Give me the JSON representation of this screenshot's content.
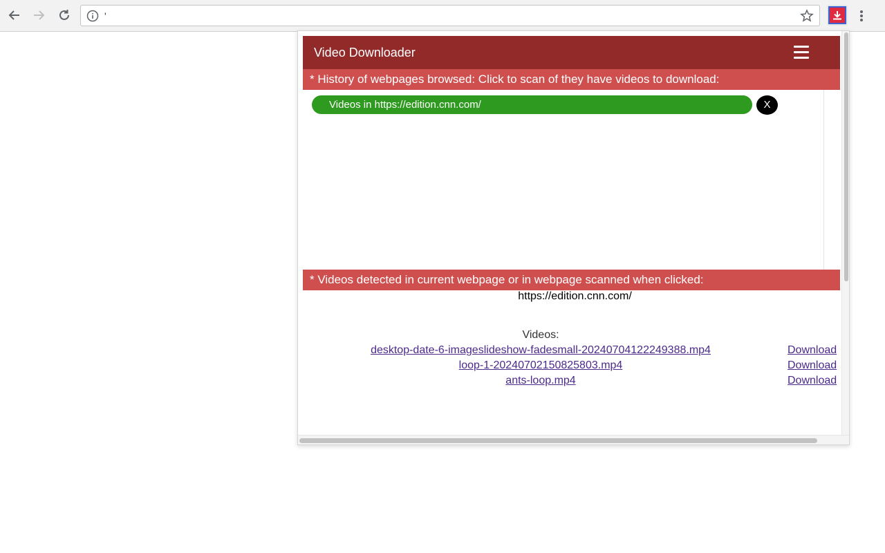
{
  "browser": {
    "url_text": "'",
    "icons": {
      "back": "arrow-left-icon",
      "forward": "arrow-right-icon",
      "reload": "reload-icon",
      "info": "info-icon",
      "bookmark": "star-icon",
      "extension": "download-icon",
      "menu": "kebab-menu-icon"
    }
  },
  "popup": {
    "title": "Video Downloader",
    "history_heading": "* History of webpages browsed: Click to scan of they have videos to download:",
    "history_items": [
      {
        "label": "Videos in https://edition.cnn.com/",
        "remove_label": "X"
      }
    ],
    "videos_heading": "* Videos detected in current webpage or in webpage scanned when clicked:",
    "current_url": "https://edition.cnn.com/",
    "videos_label": "Videos:",
    "videos": [
      {
        "name": "desktop-date-6-imageslideshow-fadesmall-20240704122249388.mp4",
        "action": "Download"
      },
      {
        "name": "loop-1-20240702150825803.mp4",
        "action": "Download"
      },
      {
        "name": "ants-loop.mp4",
        "action": "Download"
      }
    ]
  },
  "colors": {
    "header": "#922a2a",
    "section_bar": "#cf4f4f",
    "history_pill": "#2e9a1f",
    "link": "#4b2a8b"
  }
}
